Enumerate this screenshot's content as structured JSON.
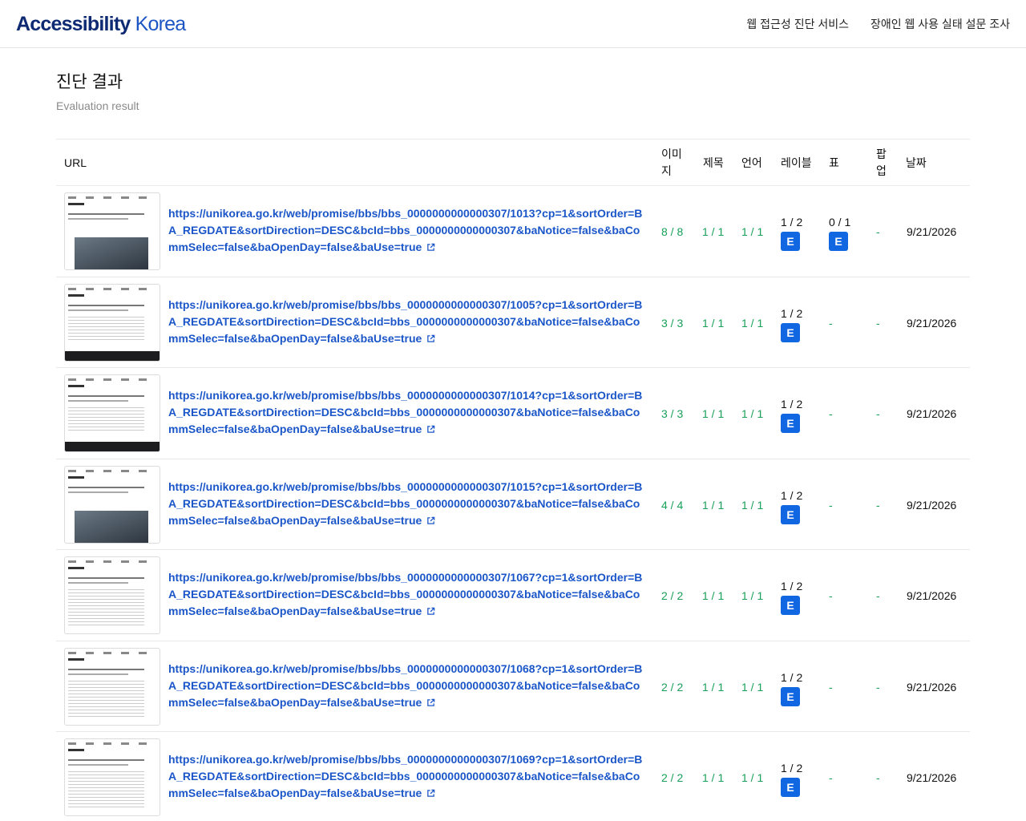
{
  "header": {
    "logo_bold": "Accessibility",
    "logo_light": "Korea",
    "nav": [
      "웹 접근성 진단 서비스",
      "장애인 웹 사용 실태 설문 조사"
    ]
  },
  "page": {
    "title": "진단 결과",
    "subtitle": "Evaluation result"
  },
  "table": {
    "columns": {
      "url": "URL",
      "image": "이미지",
      "title": "제목",
      "language": "언어",
      "label": "레이블",
      "table": "표",
      "popup": "팝업",
      "date": "날짜"
    },
    "rows": [
      {
        "url": "https://unikorea.go.kr/web/promise/bbs/bbs_0000000000000307/1013?cp=1&sortOrder=BA_REGDATE&sortDirection=DESC&bcId=bbs_0000000000000307&baNotice=false&baCommSelec=false&baOpenDay=false&baUse=true",
        "image": "8 / 8",
        "title": "1 / 1",
        "language": "1 / 1",
        "label": "1 / 2",
        "label_badge": "E",
        "table": "0 / 1",
        "table_badge": "E",
        "popup": "-",
        "date": "9/21/2026",
        "thumb": "photo"
      },
      {
        "url": "https://unikorea.go.kr/web/promise/bbs/bbs_0000000000000307/1005?cp=1&sortOrder=BA_REGDATE&sortDirection=DESC&bcId=bbs_0000000000000307&baNotice=false&baCommSelec=false&baOpenDay=false&baUse=true",
        "image": "3 / 3",
        "title": "1 / 1",
        "language": "1 / 1",
        "label": "1 / 2",
        "label_badge": "E",
        "table": "-",
        "popup": "-",
        "date": "9/21/2026",
        "thumb": "footer"
      },
      {
        "url": "https://unikorea.go.kr/web/promise/bbs/bbs_0000000000000307/1014?cp=1&sortOrder=BA_REGDATE&sortDirection=DESC&bcId=bbs_0000000000000307&baNotice=false&baCommSelec=false&baOpenDay=false&baUse=true",
        "image": "3 / 3",
        "title": "1 / 1",
        "language": "1 / 1",
        "label": "1 / 2",
        "label_badge": "E",
        "table": "-",
        "popup": "-",
        "date": "9/21/2026",
        "thumb": "footer"
      },
      {
        "url": "https://unikorea.go.kr/web/promise/bbs/bbs_0000000000000307/1015?cp=1&sortOrder=BA_REGDATE&sortDirection=DESC&bcId=bbs_0000000000000307&baNotice=false&baCommSelec=false&baOpenDay=false&baUse=true",
        "image": "4 / 4",
        "title": "1 / 1",
        "language": "1 / 1",
        "label": "1 / 2",
        "label_badge": "E",
        "table": "-",
        "popup": "-",
        "date": "9/21/2026",
        "thumb": "photo"
      },
      {
        "url": "https://unikorea.go.kr/web/promise/bbs/bbs_0000000000000307/1067?cp=1&sortOrder=BA_REGDATE&sortDirection=DESC&bcId=bbs_0000000000000307&baNotice=false&baCommSelec=false&baOpenDay=false&baUse=true",
        "image": "2 / 2",
        "title": "1 / 1",
        "language": "1 / 1",
        "label": "1 / 2",
        "label_badge": "E",
        "table": "-",
        "popup": "-",
        "date": "9/21/2026",
        "thumb": "text"
      },
      {
        "url": "https://unikorea.go.kr/web/promise/bbs/bbs_0000000000000307/1068?cp=1&sortOrder=BA_REGDATE&sortDirection=DESC&bcId=bbs_0000000000000307&baNotice=false&baCommSelec=false&baOpenDay=false&baUse=true",
        "image": "2 / 2",
        "title": "1 / 1",
        "language": "1 / 1",
        "label": "1 / 2",
        "label_badge": "E",
        "table": "-",
        "popup": "-",
        "date": "9/21/2026",
        "thumb": "text"
      },
      {
        "url": "https://unikorea.go.kr/web/promise/bbs/bbs_0000000000000307/1069?cp=1&sortOrder=BA_REGDATE&sortDirection=DESC&bcId=bbs_0000000000000307&baNotice=false&baCommSelec=false&baOpenDay=false&baUse=true",
        "image": "2 / 2",
        "title": "1 / 1",
        "language": "1 / 1",
        "label": "1 / 2",
        "label_badge": "E",
        "table": "-",
        "popup": "-",
        "date": "9/21/2026",
        "thumb": "text"
      }
    ]
  },
  "colors": {
    "pass": "#18a058",
    "link": "#1b56c9",
    "badge": "#1167e2",
    "logo": "#0e2a73"
  },
  "icons": {
    "external_link": "external-link-icon"
  }
}
